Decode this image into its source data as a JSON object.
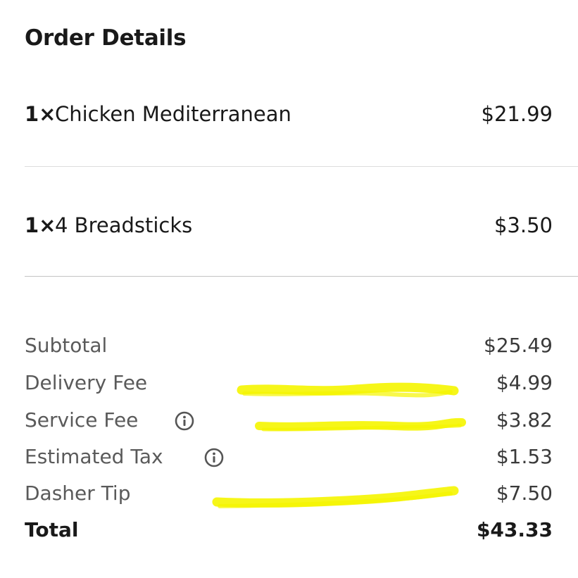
{
  "order_details": {
    "title": "Order Details",
    "items": [
      {
        "qty": "1×",
        "name": "Chicken Mediterranean",
        "price": "$21.99"
      },
      {
        "qty": "1×",
        "name": "4 Breadsticks",
        "price": "$3.50"
      }
    ],
    "summary": {
      "subtotal": {
        "label": "Subtotal",
        "value": "$25.49"
      },
      "delivery_fee": {
        "label": "Delivery Fee",
        "value": "$4.99"
      },
      "service_fee": {
        "label": "Service Fee",
        "value": "$3.82"
      },
      "estimated_tax": {
        "label": "Estimated Tax",
        "value": "$1.53"
      },
      "dasher_tip": {
        "label": "Dasher Tip",
        "value": "$7.50"
      },
      "total": {
        "label": "Total",
        "value": "$43.33"
      }
    }
  },
  "icons": {
    "service_fee_info": "info-icon",
    "estimated_tax_info": "info-icon"
  },
  "colors": {
    "highlight": "#f5f500",
    "divider": "#d8d8d8",
    "text_primary": "#191919",
    "text_secondary": "#5a5a5a"
  }
}
